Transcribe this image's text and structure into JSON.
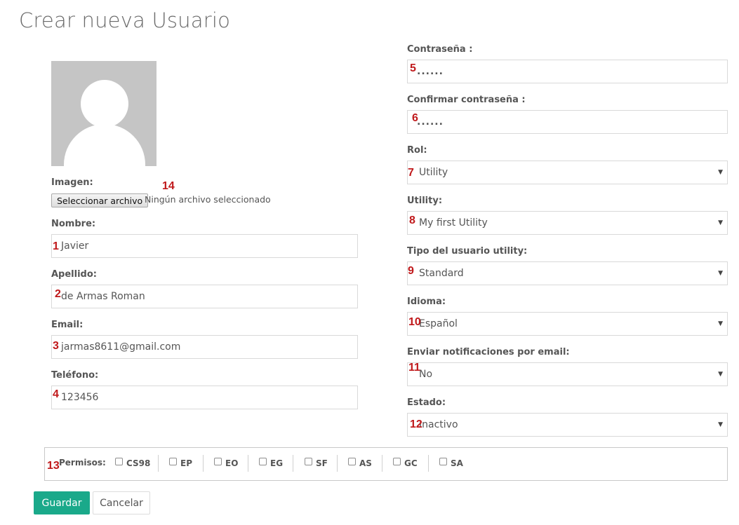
{
  "page": {
    "title": "Crear nueva Usuario"
  },
  "image": {
    "label": "Imagen:",
    "button_label": "Seleccionar archivo",
    "status": "Ningún archivo seleccionado",
    "marker": "14"
  },
  "left_fields": [
    {
      "label": "Nombre:",
      "value": "Javier",
      "marker": "1"
    },
    {
      "label": "Apellido:",
      "value": "de Armas Roman",
      "marker": "2"
    },
    {
      "label": "Email:",
      "value": "jarmas8611@gmail.com",
      "marker": "3"
    },
    {
      "label": "Teléfono:",
      "value": "123456",
      "marker": "4"
    }
  ],
  "right_fields": [
    {
      "label": "Contraseña :",
      "value": "......",
      "type": "password",
      "marker": "5"
    },
    {
      "label": "Confirmar contraseña :",
      "value": "......",
      "type": "password",
      "marker": "6"
    },
    {
      "label": "Rol:",
      "value": "Utility",
      "type": "select",
      "marker": "7"
    },
    {
      "label": "Utility:",
      "value": "My first Utility",
      "type": "select",
      "marker": "8"
    },
    {
      "label": "Tipo del usuario utility:",
      "value": "Standard",
      "type": "select",
      "marker": "9"
    },
    {
      "label": "Idioma:",
      "value": "Español",
      "type": "select",
      "marker": "10"
    },
    {
      "label": "Enviar notificaciones por email:",
      "value": "No",
      "type": "select",
      "marker": "11"
    },
    {
      "label": "Estado:",
      "value": "Inactivo",
      "type": "select",
      "marker": "12"
    }
  ],
  "permissions": {
    "label": "Permisos:",
    "marker": "13",
    "items": [
      "CS98",
      "EP",
      "EO",
      "EG",
      "SF",
      "AS",
      "GC",
      "SA"
    ]
  },
  "actions": {
    "save_label": "Guardar",
    "cancel_label": "Cancelar"
  },
  "colors": {
    "accent": "#1aa98a",
    "marker": "#c0191b"
  }
}
